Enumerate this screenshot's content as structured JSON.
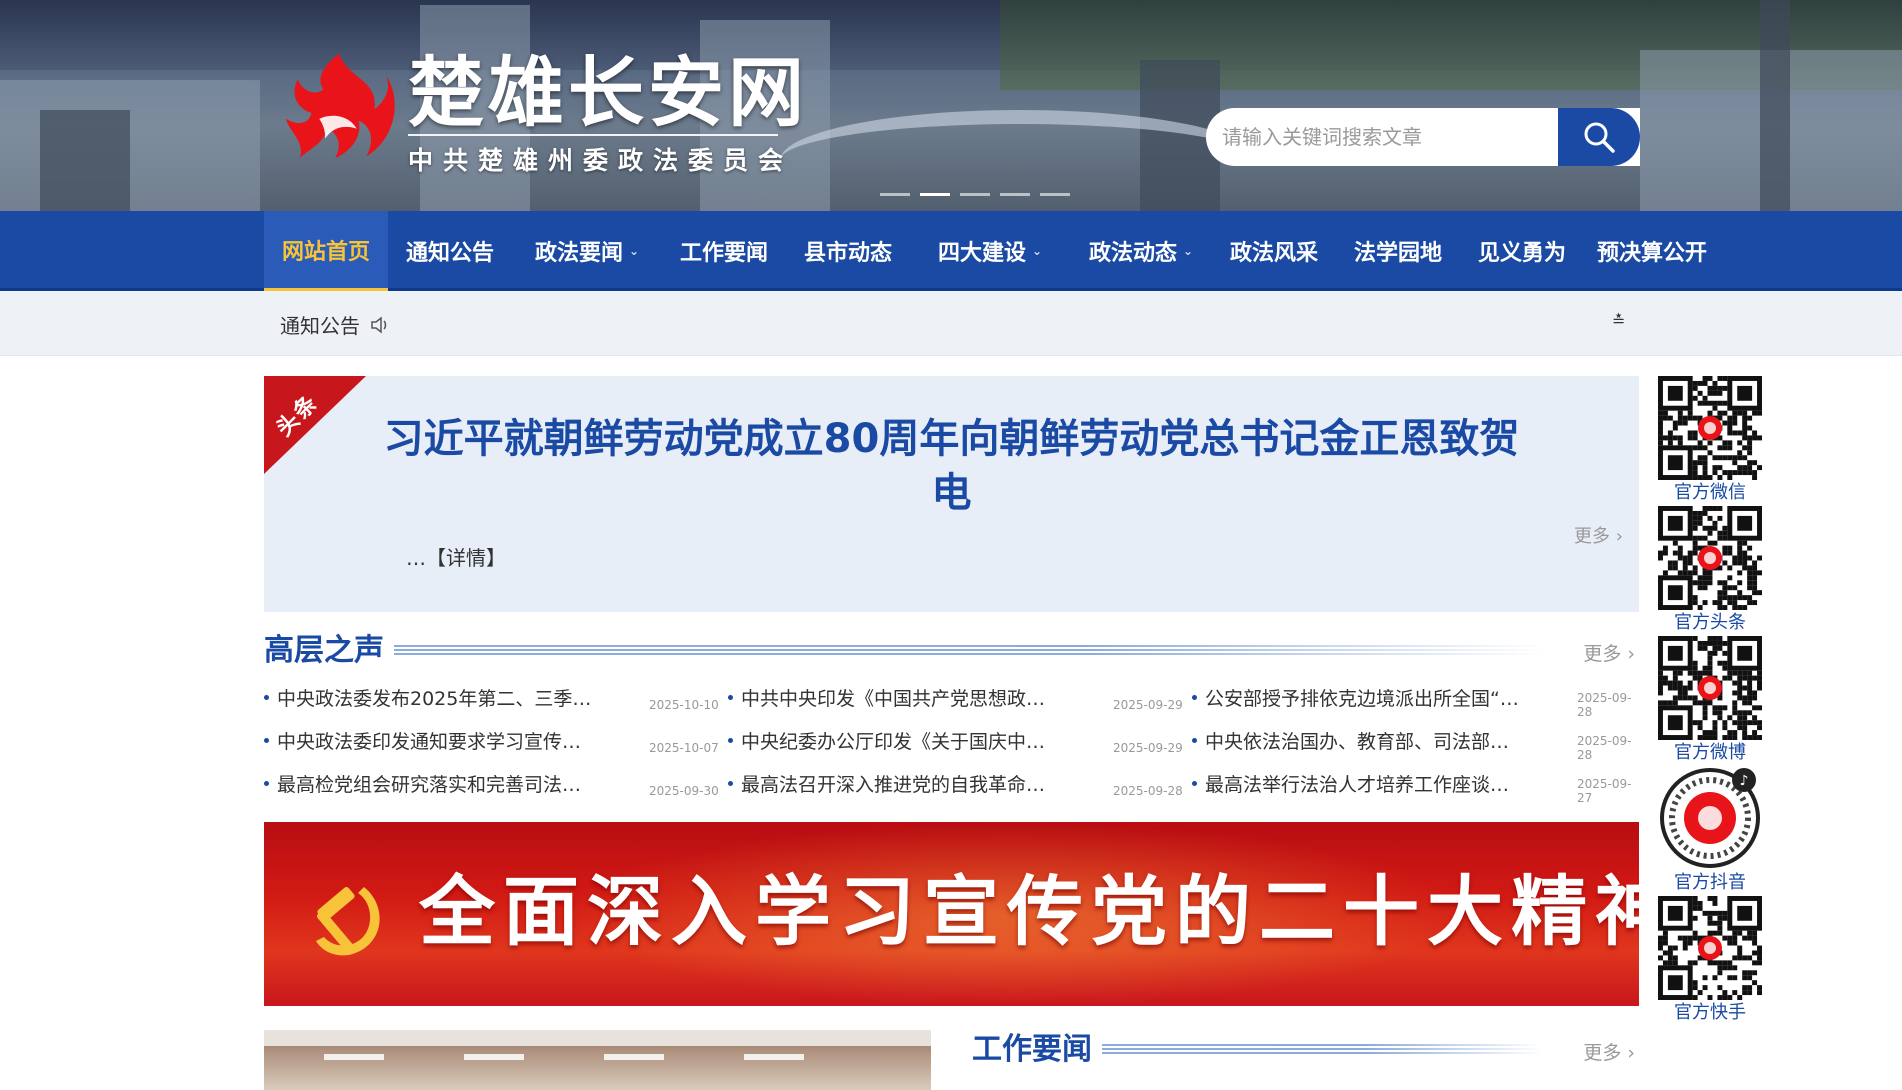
{
  "header": {
    "site_title": "楚雄长安网",
    "site_subtitle": "中共楚雄州委政法委员会",
    "search_placeholder": "请输入关键词搜索文章"
  },
  "nav": {
    "items": [
      {
        "label": "网站首页",
        "active": true,
        "dropdown": false
      },
      {
        "label": "通知公告",
        "dropdown": false
      },
      {
        "label": "政法要闻",
        "dropdown": true
      },
      {
        "label": "工作要闻",
        "dropdown": false
      },
      {
        "label": "县市动态",
        "dropdown": false
      },
      {
        "label": "四大建设",
        "dropdown": true
      },
      {
        "label": "政法动态",
        "dropdown": true
      },
      {
        "label": "政法风采",
        "dropdown": false
      },
      {
        "label": "法学园地",
        "dropdown": false
      },
      {
        "label": "见义勇为",
        "dropdown": false
      },
      {
        "label": "预决算公开",
        "dropdown": false
      }
    ]
  },
  "notice": {
    "label": "通知公告",
    "end_marker": "≛"
  },
  "headline": {
    "ribbon": "头条",
    "title": "习近平就朝鲜劳动党成立80周年向朝鲜劳动党总书记金正恩致贺电",
    "detail": "…【详情】",
    "more": "更多 ›"
  },
  "sections": {
    "gaoceng": {
      "title": "高层之声",
      "more": "更多 ›"
    },
    "gongzuo": {
      "title": "工作要闻",
      "more": "更多 ›"
    }
  },
  "news": {
    "rows": [
      [
        {
          "text": "中央政法委发布2025年第二、三季…",
          "date": "2025-10-10"
        },
        {
          "text": "中共中央印发《中国共产党思想政…",
          "date": "2025-09-29"
        },
        {
          "text": "公安部授予排依克边境派出所全国“…",
          "date": "2025-09-28"
        }
      ],
      [
        {
          "text": "中央政法委印发通知要求学习宣传…",
          "date": "2025-10-07"
        },
        {
          "text": "中央纪委办公厅印发《关于国庆中…",
          "date": "2025-09-29"
        },
        {
          "text": "中央依法治国办、教育部、司法部…",
          "date": "2025-09-28"
        }
      ],
      [
        {
          "text": "最高检党组会研究落实和完善司法…",
          "date": "2025-09-30"
        },
        {
          "text": "最高法召开深入推进党的自我革命…",
          "date": "2025-09-28"
        },
        {
          "text": "最高法举行法治人才培养工作座谈…",
          "date": "2025-09-27"
        }
      ]
    ]
  },
  "banner": {
    "text": "全面深入学习宣传党的二十大精神"
  },
  "qr_codes": [
    {
      "label": "官方微信",
      "badge": ""
    },
    {
      "label": "官方头条",
      "badge": "头条"
    },
    {
      "label": "官方微博",
      "badge": ""
    },
    {
      "label": "官方抖音",
      "badge": ""
    },
    {
      "label": "官方快手",
      "badge": ""
    }
  ],
  "colors": {
    "primary_blue": "#1a4aa3",
    "active_yellow": "#f7c338",
    "red": "#c8161d"
  }
}
